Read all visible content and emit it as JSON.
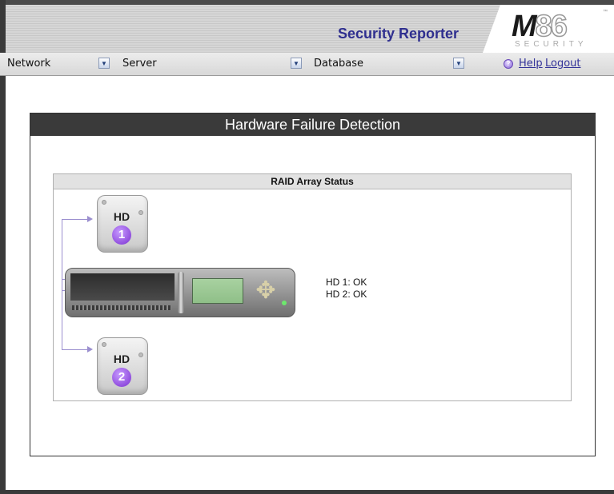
{
  "header": {
    "app_title": "Security Reporter",
    "logo_text": "M86",
    "logo_sub": "SECURITY",
    "logo_tm": "™"
  },
  "nav": {
    "network_label": "Network",
    "server_label": "Server",
    "database_label": "Database",
    "help_label": "Help",
    "logout_label": "Logout",
    "help_icon": "question-icon"
  },
  "panel": {
    "title": "Hardware Failure Detection"
  },
  "raid": {
    "title": "RAID Array Status",
    "disks": [
      {
        "label": "HD",
        "number": "1"
      },
      {
        "label": "HD",
        "number": "2"
      }
    ],
    "status_lines": [
      "HD 1: OK",
      "HD 2: OK"
    ]
  },
  "colors": {
    "app_title": "#2f2f8f",
    "panel_header": "#3a3a3a",
    "link": "#333399",
    "disk_badge": "#7a2fd0",
    "connector": "#9b8fcf"
  }
}
